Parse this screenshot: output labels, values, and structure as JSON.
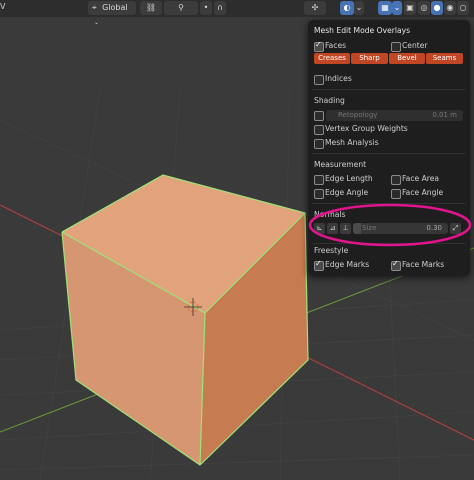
{
  "topbar": {
    "partial_label": "V",
    "orientation": "Global"
  },
  "panel": {
    "title": "Mesh Edit Mode Overlays",
    "faces": "Faces",
    "center": "Center",
    "creases": "Creases",
    "sharp": "Sharp",
    "bevel": "Bevel",
    "seams": "Seams",
    "indices": "Indices",
    "shading_header": "Shading",
    "retopology": "Retopology",
    "retopology_value": "0.01 m",
    "vertex_group_weights": "Vertex Group Weights",
    "mesh_analysis": "Mesh Analysis",
    "measurement_header": "Measurement",
    "edge_length": "Edge Length",
    "face_area": "Face Area",
    "edge_angle": "Edge Angle",
    "face_angle": "Face Angle",
    "normals_header": "Normals",
    "size_label": "Size",
    "size_value": "0.30",
    "freestyle_header": "Freestyle",
    "edge_marks": "Edge Marks",
    "face_marks": "Face Marks"
  },
  "checkboxes": {
    "faces": true,
    "center": false,
    "indices": false,
    "retopology": false,
    "vertex_group_weights": false,
    "mesh_analysis": false,
    "edge_length": false,
    "face_area": false,
    "edge_angle": false,
    "face_angle": false,
    "edge_marks": true,
    "face_marks": true
  },
  "colors": {
    "viewport_bg": "#3a3a3a",
    "cube_top": "#e1a27c",
    "cube_front": "#d69671",
    "cube_side": "#c77b50",
    "edge_highlight": "#9ee27a",
    "x_axis": "#b5443d",
    "y_axis": "#6c9a3a",
    "accent_red": "#c14624",
    "annotation_magenta": "#e0148c"
  },
  "icons": [
    "mesh-vertex-icon",
    "box-select-icon",
    "view-icon",
    "transform-icon",
    "cursor-icon",
    "overlays-icon",
    "xray-icon",
    "shading-icon",
    "vertex-normal-icon",
    "split-normal-icon",
    "face-normal-icon",
    "constant-size-icon",
    "object-origin-icon"
  ]
}
